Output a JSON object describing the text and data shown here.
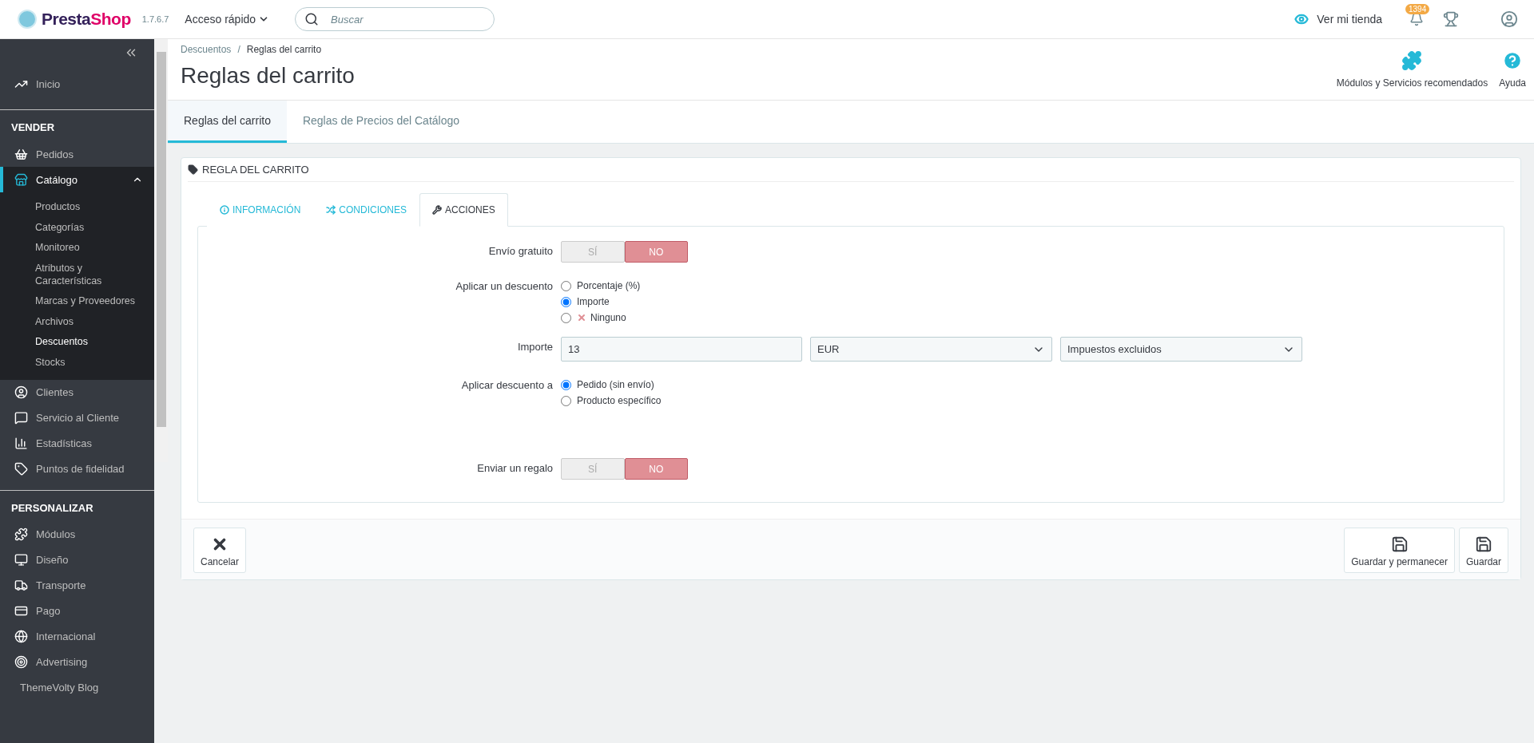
{
  "topbar": {
    "logo": [
      "Presta",
      "Shop"
    ],
    "version": "1.7.6.7",
    "quick_access": "Acceso rápido",
    "search": {
      "placeholder": "Buscar"
    },
    "view_store": "Ver mi tienda",
    "notifications": "1394"
  },
  "sidebar": {
    "groups": [
      {
        "items": [
          {
            "label": "Inicio",
            "selected": false
          }
        ]
      },
      {
        "heading": "VENDER",
        "items": [
          {
            "label": "Pedidos",
            "selected": false
          },
          {
            "label": "Catálogo",
            "selected": true,
            "expanded": true,
            "children": [
              {
                "label": "Productos",
                "selected": false
              },
              {
                "label": "Categorías",
                "selected": false
              },
              {
                "label": "Monitoreo",
                "selected": false
              },
              {
                "label": "Atributos y Características",
                "selected": false
              },
              {
                "label": "Marcas y Proveedores",
                "selected": false
              },
              {
                "label": "Archivos",
                "selected": false
              },
              {
                "label": "Descuentos",
                "selected": true
              },
              {
                "label": "Stocks",
                "selected": false
              }
            ]
          },
          {
            "label": "Clientes",
            "selected": false
          },
          {
            "label": "Servicio al Cliente",
            "selected": false
          },
          {
            "label": "Estadísticas",
            "selected": false
          },
          {
            "label": "Puntos de fidelidad",
            "selected": false
          }
        ]
      },
      {
        "heading": "PERSONALIZAR",
        "items": [
          {
            "label": "Módulos",
            "selected": false
          },
          {
            "label": "Diseño",
            "selected": false
          },
          {
            "label": "Transporte",
            "selected": false
          },
          {
            "label": "Pago",
            "selected": false
          },
          {
            "label": "Internacional",
            "selected": false
          },
          {
            "label": "Advertising",
            "selected": false
          },
          {
            "label": "ThemeVolty Blog",
            "selected": false
          }
        ]
      }
    ]
  },
  "breadcrumb": [
    "Descuentos",
    "Reglas del carrito"
  ],
  "breadcrumb_separator": "/",
  "title": "Reglas del carrito",
  "toolbar": [
    "Módulos y Servicios recomendados",
    "Ayuda"
  ],
  "page_tabs": [
    {
      "label": "Reglas del carrito",
      "selected": true
    },
    {
      "label": "Reglas de Precios del Catálogo",
      "selected": false
    }
  ],
  "card": {
    "title": "REGLA DEL CARRITO",
    "tabs": [
      {
        "label": "INFORMACIÓN",
        "selected": false
      },
      {
        "label": "CONDICIONES",
        "selected": false
      },
      {
        "label": "ACCIONES",
        "selected": true
      }
    ],
    "rows": [
      {
        "kind": "toggle",
        "label": "Envío gratuito",
        "options": [
          {
            "label": "SÍ",
            "selected": false
          },
          {
            "label": "NO",
            "selected": true
          }
        ]
      },
      {
        "kind": "radio",
        "label": "Aplicar un descuento",
        "options": [
          {
            "label": "Porcentaje (%)",
            "selected": false,
            "kind": "plain"
          },
          {
            "label": "Importe",
            "selected": true,
            "kind": "plain"
          },
          {
            "label": "Ninguno",
            "selected": false,
            "kind": "none"
          }
        ]
      },
      {
        "kind": "fields",
        "label": "Importe",
        "value": "13",
        "selects": [
          "EUR",
          "Impuestos excluidos"
        ]
      },
      {
        "kind": "radio",
        "label": "Aplicar descuento a",
        "options": [
          {
            "label": "Pedido (sin envío)",
            "selected": true,
            "kind": "plain"
          },
          {
            "label": "Producto específico",
            "selected": false,
            "kind": "plain"
          }
        ]
      },
      {
        "kind": "toggle",
        "label": "Enviar un regalo",
        "options": [
          {
            "label": "SÍ",
            "selected": false
          },
          {
            "label": "NO",
            "selected": true
          }
        ]
      }
    ]
  },
  "footer": {
    "cancel": "Cancelar",
    "save": [
      "Guardar y permanecer",
      "Guardar"
    ]
  }
}
